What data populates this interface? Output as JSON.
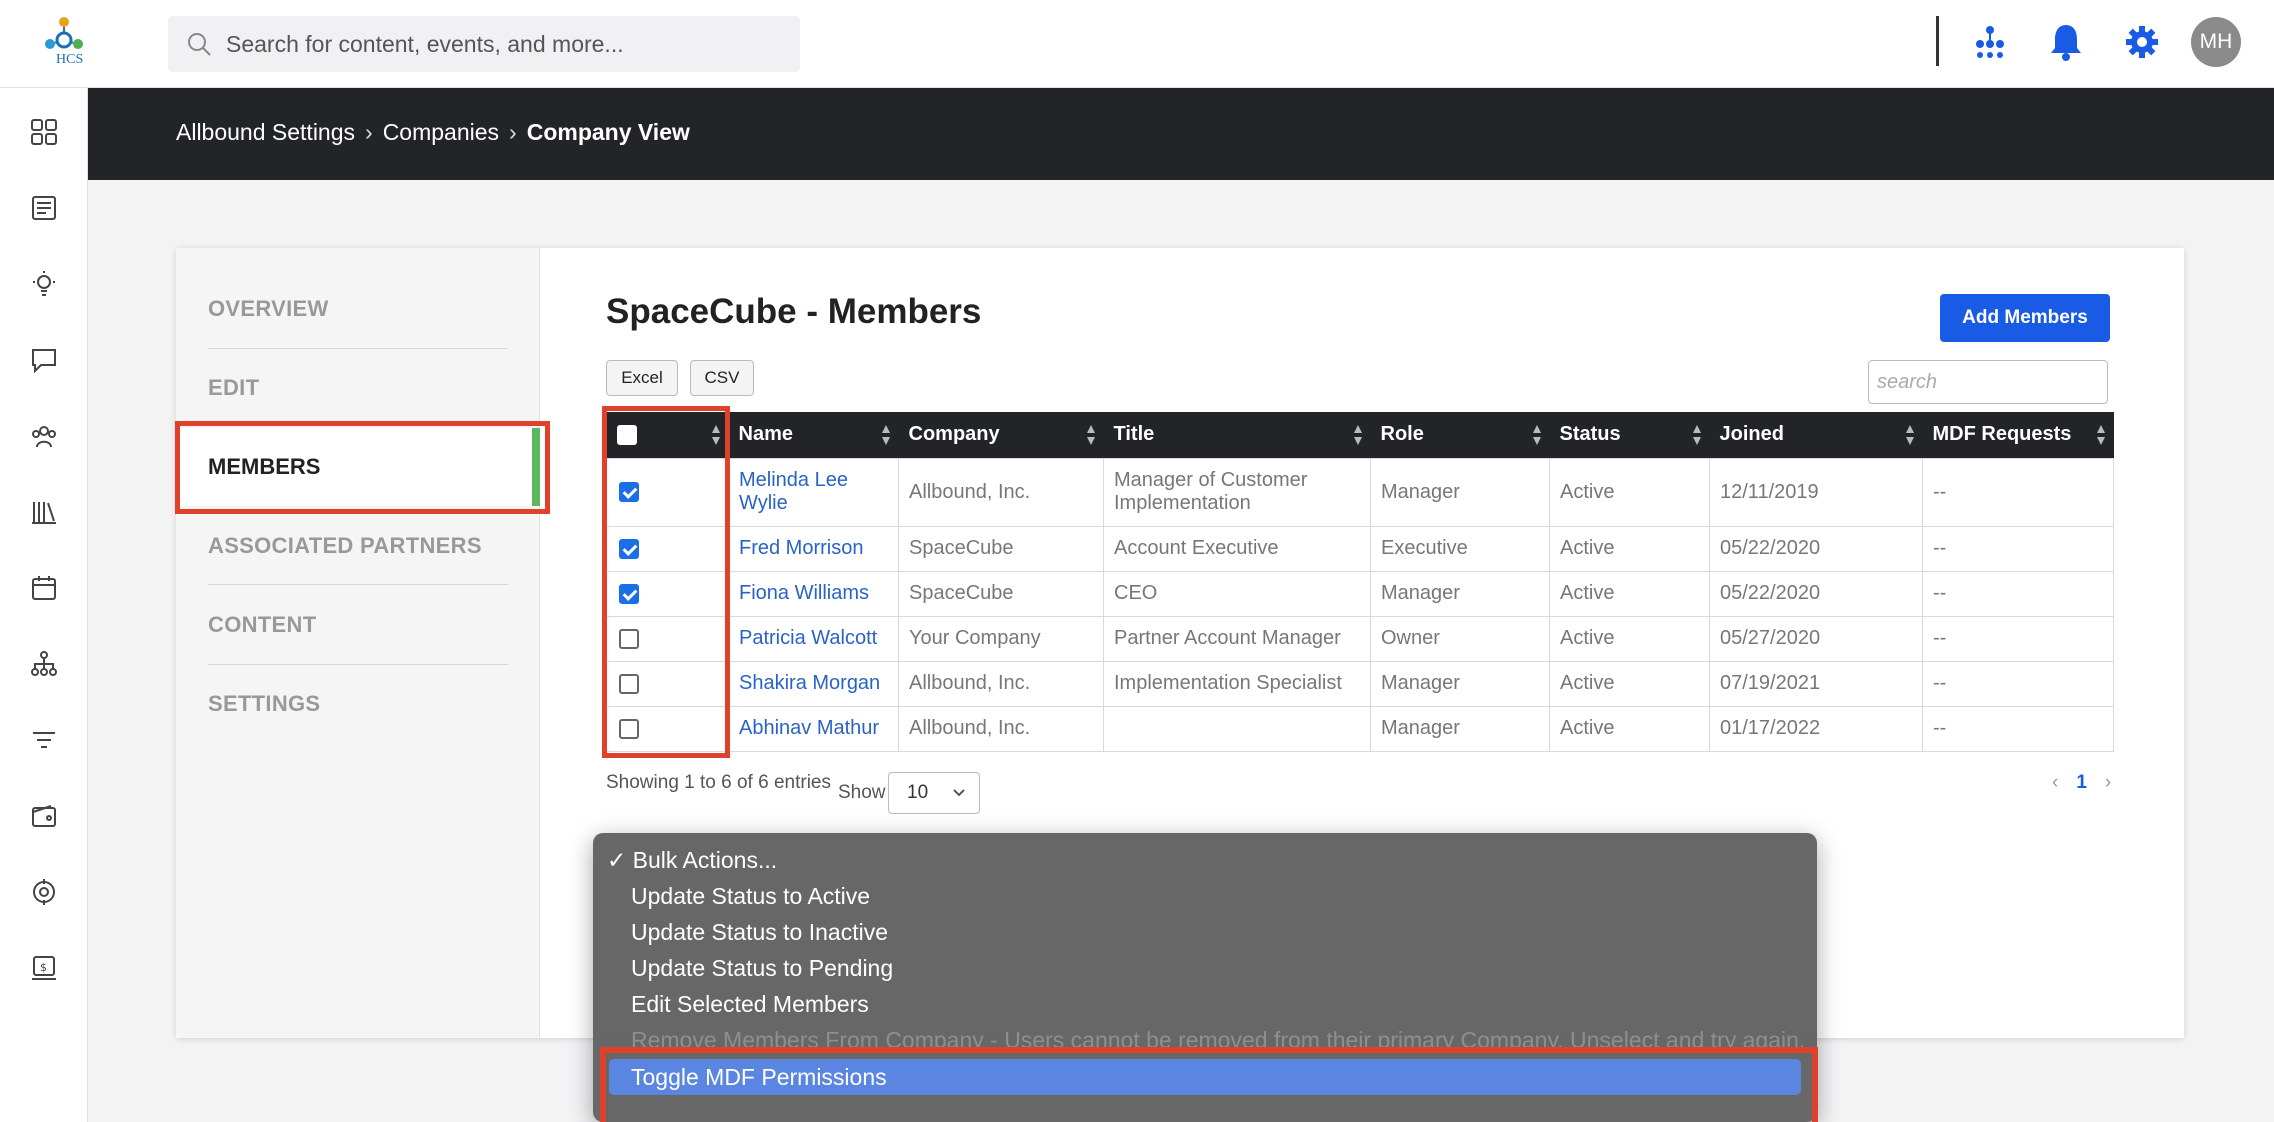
{
  "header": {
    "logo_text": "HCS",
    "search_placeholder": "Search for content, events, and more...",
    "avatar_initials": "MH"
  },
  "breadcrumb": {
    "items": [
      "Allbound Settings",
      "Companies"
    ],
    "separator": "›",
    "current": "Company View"
  },
  "subnav": {
    "items": [
      "OVERVIEW",
      "EDIT",
      "MEMBERS",
      "ASSOCIATED PARTNERS",
      "CONTENT",
      "SETTINGS"
    ],
    "active": "MEMBERS"
  },
  "main": {
    "title": "SpaceCube - Members",
    "add_button": "Add Members",
    "export_buttons": [
      "Excel",
      "CSV"
    ],
    "search_placeholder": "search"
  },
  "table": {
    "columns": [
      "Name",
      "Company",
      "Title",
      "Role",
      "Status",
      "Joined",
      "MDF Requests"
    ],
    "rows": [
      {
        "checked": true,
        "name": "Melinda Lee Wylie",
        "company": "Allbound, Inc.",
        "title": "Manager of Customer Implementation",
        "role": "Manager",
        "status": "Active",
        "joined": "12/11/2019",
        "mdf": "--"
      },
      {
        "checked": true,
        "name": "Fred Morrison",
        "company": "SpaceCube",
        "title": "Account Executive",
        "role": "Executive",
        "status": "Active",
        "joined": "05/22/2020",
        "mdf": "--"
      },
      {
        "checked": true,
        "name": "Fiona Williams",
        "company": "SpaceCube",
        "title": "CEO",
        "role": "Manager",
        "status": "Active",
        "joined": "05/22/2020",
        "mdf": "--"
      },
      {
        "checked": false,
        "name": "Patricia Walcott",
        "company": "Your Company",
        "title": "Partner Account Manager",
        "role": "Owner",
        "status": "Active",
        "joined": "05/27/2020",
        "mdf": "--"
      },
      {
        "checked": false,
        "name": "Shakira Morgan",
        "company": "Allbound, Inc.",
        "title": "Implementation Specialist",
        "role": "Manager",
        "status": "Active",
        "joined": "07/19/2021",
        "mdf": "--"
      },
      {
        "checked": false,
        "name": "Abhinav Mathur",
        "company": "Allbound, Inc.",
        "title": "",
        "role": "Manager",
        "status": "Active",
        "joined": "01/17/2022",
        "mdf": "--"
      }
    ]
  },
  "footer": {
    "info": "Showing 1 to 6 of 6 entries",
    "show_label": "Show",
    "show_value": "10",
    "page_prev": "‹",
    "page_current": "1",
    "page_next": "›"
  },
  "bulk_menu": {
    "check_mark": "✓",
    "items": [
      "Bulk Actions...",
      "Update Status to Active",
      "Update Status to Inactive",
      "Update Status to Pending",
      "Edit Selected Members",
      "Remove Members From Company - Users cannot be removed from their primary Company. Unselect and try again.",
      "Toggle MDF Permissions"
    ],
    "selected_index": 6,
    "disabled_index": 5
  },
  "colors": {
    "accent": "#1a5be6",
    "highlight": "#e0412b",
    "active_bar": "#5cb85c",
    "header_dark": "#232427"
  },
  "icons": {
    "rail": [
      "dashboard-icon",
      "news-icon",
      "lightbulb-icon",
      "chat-icon",
      "people-icon",
      "library-icon",
      "calendar-icon",
      "hierarchy-icon",
      "filter-icon",
      "wallet-icon",
      "target-icon",
      "payment-icon"
    ],
    "header": [
      "org-chart-icon",
      "bell-icon",
      "gear-icon"
    ]
  }
}
